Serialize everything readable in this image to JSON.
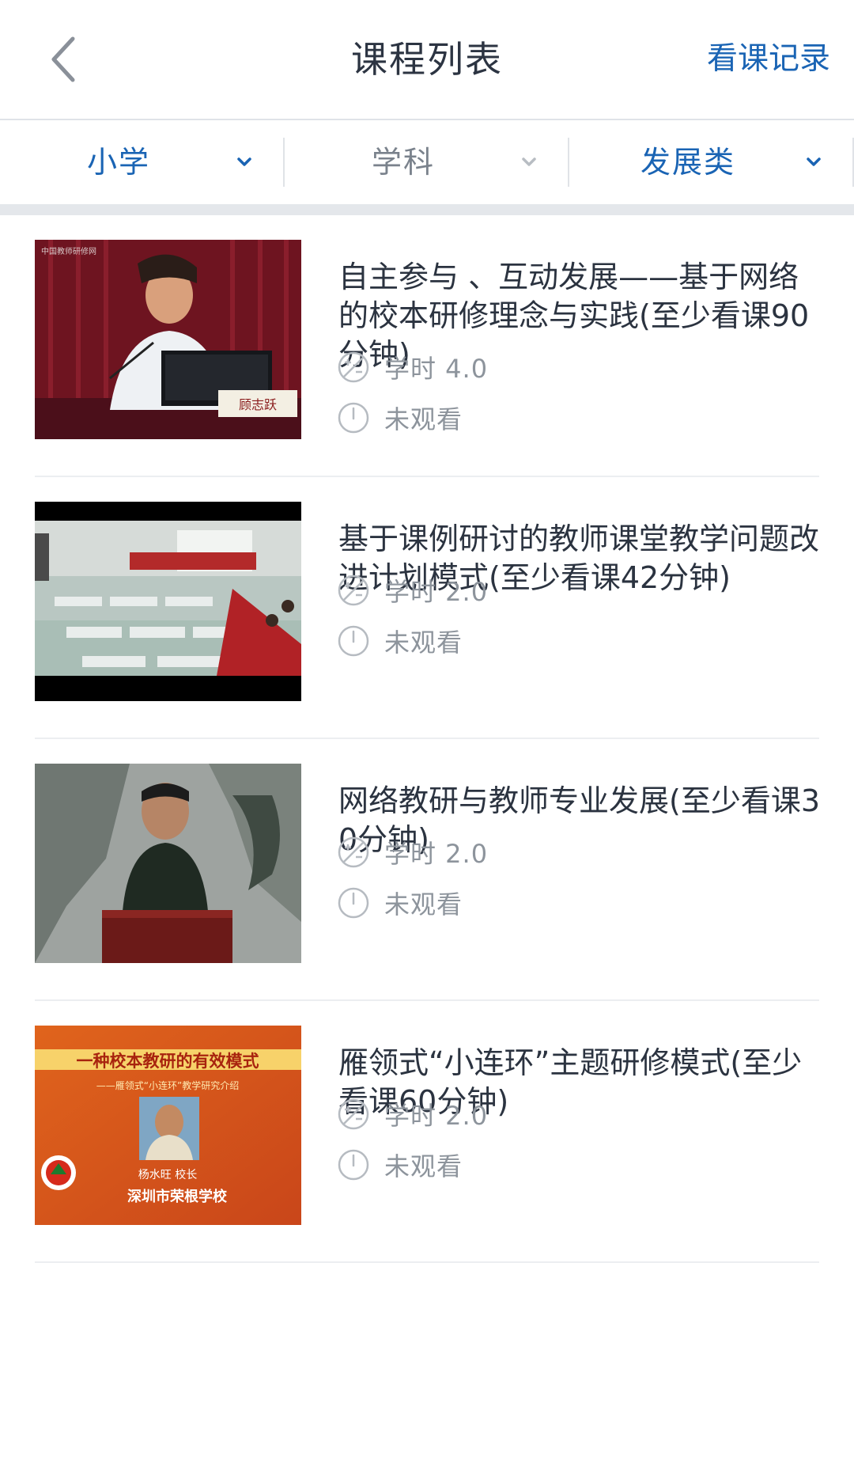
{
  "header": {
    "title": "课程列表",
    "history_label": "看课记录"
  },
  "filters": [
    {
      "label": "小学",
      "active": true
    },
    {
      "label": "学科",
      "active": false
    },
    {
      "label": "发展类",
      "active": true
    }
  ],
  "courses": [
    {
      "title": "自主参与 、互动发展——基于网络的校本研修理念与实践(至少看课90分钟)",
      "hours_label": "学时 4.0",
      "status": "未观看",
      "thumb_caption": "顾志跃",
      "thumb_watermark": "中国教师研修网"
    },
    {
      "title": "基于课例研讨的教师课堂教学问题改进计划模式(至少看课42分钟)",
      "hours_label": "学时 2.0",
      "status": "未观看"
    },
    {
      "title": "网络教研与教师专业发展(至少看课30分钟)",
      "hours_label": "学时 2.0",
      "status": "未观看"
    },
    {
      "title": "雁领式“小连环”主题研修模式(至少看课60分钟)",
      "hours_label": "学时 2.0",
      "status": "未观看",
      "thumb_line1": "一种校本教研的有效模式",
      "thumb_line2": "——雁领式“小连环”教学研究介绍",
      "thumb_line3": "杨水旺 校长",
      "thumb_line4": "深圳市荣根学校"
    }
  ],
  "colors": {
    "accent": "#1a64b4",
    "title_text": "#2b3340",
    "meta_text": "#8d949c"
  },
  "icons": {
    "back": "chevron-left-icon",
    "chevron": "chevron-down-icon",
    "hours": "hours-icon",
    "status": "clock-icon"
  }
}
